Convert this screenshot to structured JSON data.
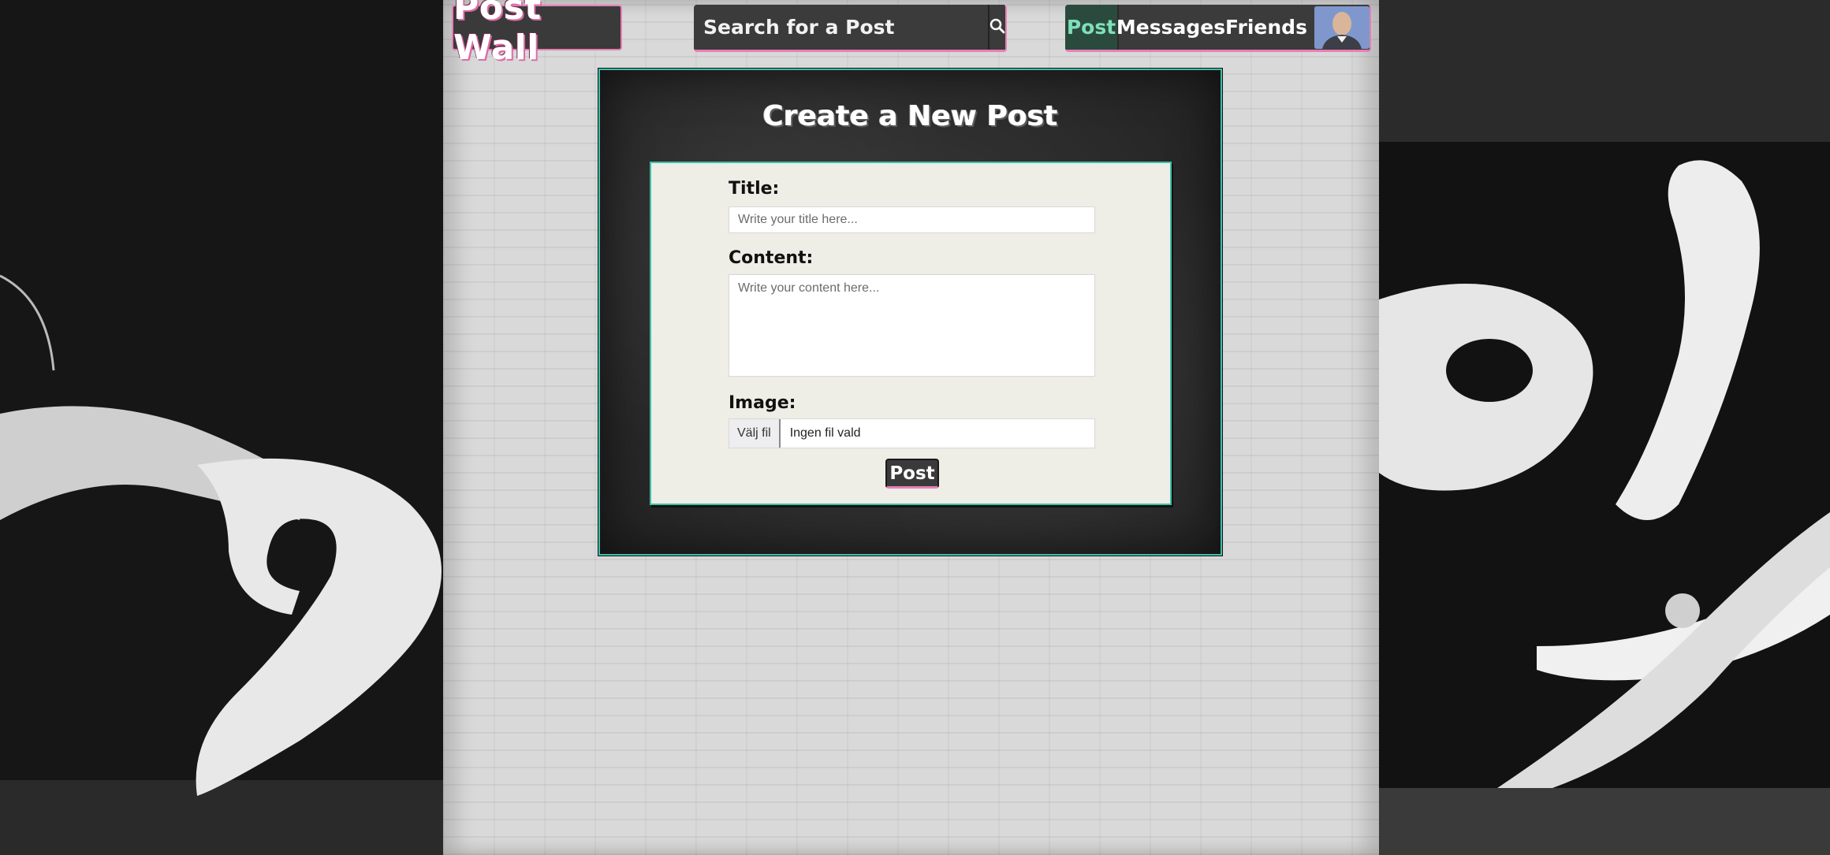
{
  "header": {
    "logo_text": "Post Wall",
    "search_placeholder": "Search for a Post",
    "search_icon": "search-icon",
    "nav": {
      "post_label": "Post",
      "messages_label": "Messages",
      "friends_label": "Friends",
      "avatar_icon": "user-avatar"
    }
  },
  "form": {
    "heading": "Create a New Post",
    "title_label": "Title:",
    "title_placeholder": "Write your title here...",
    "content_label": "Content:",
    "content_placeholder": "Write your content here...",
    "image_label": "Image:",
    "file_button_label": "Välj fil",
    "file_status": "Ingen fil vald",
    "submit_label": "Post"
  },
  "colors": {
    "accent_pink": "#e87fb5",
    "accent_teal": "#3dbfa8",
    "active_nav_text": "#7ee0b8",
    "dark_panel": "#3b3b3b",
    "form_bg": "#eeede6"
  }
}
